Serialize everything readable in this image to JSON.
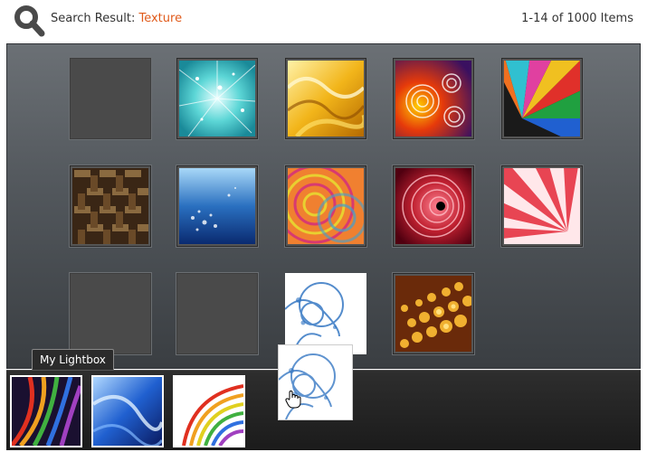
{
  "header": {
    "search_label": "Search Result:",
    "search_term": "Texture",
    "result_count": "1-14 of 1000 Items",
    "icon": "magnifier-icon",
    "accent_color": "#e05a1a"
  },
  "gallery": {
    "tiles": [
      {
        "name": "empty"
      },
      {
        "name": "cyan-sparkle-texture"
      },
      {
        "name": "golden-wave-texture"
      },
      {
        "name": "red-spiral-texture"
      },
      {
        "name": "colorful-wheel-texture"
      },
      {
        "name": "woven-basket-texture"
      },
      {
        "name": "blue-bubbles-texture"
      },
      {
        "name": "orange-rings-texture"
      },
      {
        "name": "red-vortex-texture"
      },
      {
        "name": "red-burst-texture"
      },
      {
        "name": "empty"
      },
      {
        "name": "empty"
      },
      {
        "name": "blue-swirl-texture"
      },
      {
        "name": "golden-dots-texture"
      }
    ]
  },
  "lightbox": {
    "tab_label": "My Lightbox",
    "items": [
      {
        "name": "rainbow-flow-texture"
      },
      {
        "name": "blue-silk-texture"
      },
      {
        "name": "rainbow-arc-texture"
      }
    ]
  },
  "drag": {
    "item": "blue-swirl-texture",
    "cursor": "hand-cursor-icon"
  }
}
